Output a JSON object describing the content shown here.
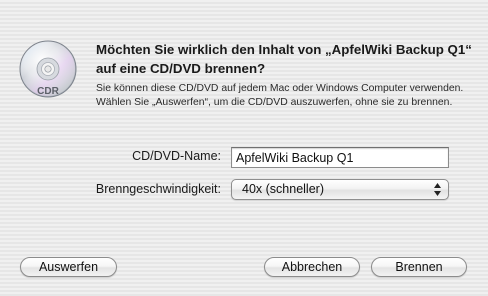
{
  "dialog": {
    "icon": "cd-r-disc-icon",
    "disc_label": "CDR",
    "title": "Möchten Sie wirklich den Inhalt von „ApfelWiki Backup Q1“ auf eine CD/DVD brennen?",
    "message": "Sie können diese CD/DVD auf jedem Mac oder Windows Computer verwenden. Wählen Sie „Auswerfen“, um die CD/DVD auszuwerfen, ohne sie zu brennen."
  },
  "form": {
    "name_label": "CD/DVD-Name:",
    "name_value": "ApfelWiki Backup Q1",
    "speed_label": "Brenngeschwindigkeit:",
    "speed_value": "40x (schneller)",
    "speed_icon": "up-down-stepper-icon"
  },
  "buttons": {
    "eject": "Auswerfen",
    "cancel": "Abbrechen",
    "burn": "Brennen"
  }
}
